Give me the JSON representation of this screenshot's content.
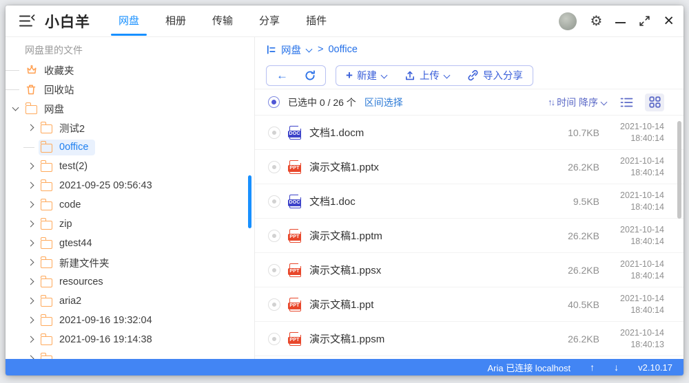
{
  "window": {
    "title": "小白羊"
  },
  "header": {
    "tabs": [
      {
        "label": "网盘",
        "cls": "active"
      },
      {
        "label": "相册",
        "cls": ""
      },
      {
        "label": "传输",
        "cls": ""
      },
      {
        "label": "分享",
        "cls": ""
      },
      {
        "label": "插件",
        "cls": ""
      }
    ]
  },
  "glyphs": {
    "back": "←",
    "plus": "+",
    "sort": "↑↓",
    "up": "↑",
    "down": "↓",
    "gear": "⚙",
    "close": "×"
  },
  "sidebar": {
    "header": "网盘里的文件",
    "items": [
      {
        "label": "收藏夹",
        "cls": "lv0 m-dash i-crown",
        "marker_click": "false"
      },
      {
        "label": "回收站",
        "cls": "lv0 m-dash i-trash",
        "marker_click": "false"
      },
      {
        "label": "网盘",
        "cls": "lv0 m-open i-folder",
        "marker_click": "true"
      },
      {
        "label": "测试2",
        "cls": "lv1 m-closed i-folder",
        "marker_click": "true"
      },
      {
        "label": "0office",
        "cls": "lv1 m-dash i-folder selected",
        "marker_click": "false"
      },
      {
        "label": "test(2)",
        "cls": "lv1 m-closed i-folder",
        "marker_click": "true"
      },
      {
        "label": "2021-09-25 09:56:43",
        "cls": "lv1 m-closed i-folder",
        "marker_click": "true"
      },
      {
        "label": "code",
        "cls": "lv1 m-closed i-folder",
        "marker_click": "true"
      },
      {
        "label": "zip",
        "cls": "lv1 m-closed i-folder",
        "marker_click": "true"
      },
      {
        "label": "gtest44",
        "cls": "lv1 m-closed i-folder",
        "marker_click": "true"
      },
      {
        "label": "新建文件夹",
        "cls": "lv1 m-closed i-folder",
        "marker_click": "true"
      },
      {
        "label": "resources",
        "cls": "lv1 m-closed i-folder",
        "marker_click": "true"
      },
      {
        "label": "aria2",
        "cls": "lv1 m-closed i-folder",
        "marker_click": "true"
      },
      {
        "label": "2021-09-16 19:32:04",
        "cls": "lv1 m-closed i-folder",
        "marker_click": "true"
      },
      {
        "label": "2021-09-16 19:14:38",
        "cls": "lv1 m-closed i-folder",
        "marker_click": "true"
      },
      {
        "label": "",
        "cls": "lv1 m-closed i-folder",
        "marker_click": "true"
      }
    ]
  },
  "breadcrumb": {
    "root": "网盘",
    "separator": ">",
    "current": "0office"
  },
  "toolbar": {
    "new": "新建",
    "upload": "上传",
    "import_share": "导入分享"
  },
  "list_header": {
    "selected_text": "已选中 0 / 26 个",
    "range_select": "区间选择",
    "sort_label": "时间 降序"
  },
  "files": [
    {
      "name": "文档1.docm",
      "badge": "DOC",
      "cls": "doc",
      "size": "10.7KB",
      "date": "2021-10-14",
      "time": "18:40:14"
    },
    {
      "name": "演示文稿1.pptx",
      "badge": "PPT",
      "cls": "ppt",
      "size": "26.2KB",
      "date": "2021-10-14",
      "time": "18:40:14"
    },
    {
      "name": "文档1.doc",
      "badge": "DOC",
      "cls": "doc",
      "size": "9.5KB",
      "date": "2021-10-14",
      "time": "18:40:14"
    },
    {
      "name": "演示文稿1.pptm",
      "badge": "PPT",
      "cls": "ppt",
      "size": "26.2KB",
      "date": "2021-10-14",
      "time": "18:40:14"
    },
    {
      "name": "演示文稿1.ppsx",
      "badge": "PPT",
      "cls": "ppt",
      "size": "26.2KB",
      "date": "2021-10-14",
      "time": "18:40:14"
    },
    {
      "name": "演示文稿1.ppt",
      "badge": "PPT",
      "cls": "ppt",
      "size": "40.5KB",
      "date": "2021-10-14",
      "time": "18:40:14"
    },
    {
      "name": "演示文稿1.ppsm",
      "badge": "PPT",
      "cls": "ppt",
      "size": "26.2KB",
      "date": "2021-10-14",
      "time": "18:40:13"
    }
  ],
  "status_bar": {
    "connection": "Aria 已连接 localhost",
    "version": "v2.10.17"
  },
  "colors": {
    "accent": "#1890ff",
    "toolbar_blue": "#3a5fd9",
    "sort_indigo": "#5b69c7",
    "status_bar": "#4285f4",
    "folder_orange": "#ffa95a",
    "doc_icon": "#3d43c9",
    "ppt_icon": "#e8472b",
    "selected_bg": "#e9f1fd",
    "breadcrumb_blue": "#2470e8"
  }
}
